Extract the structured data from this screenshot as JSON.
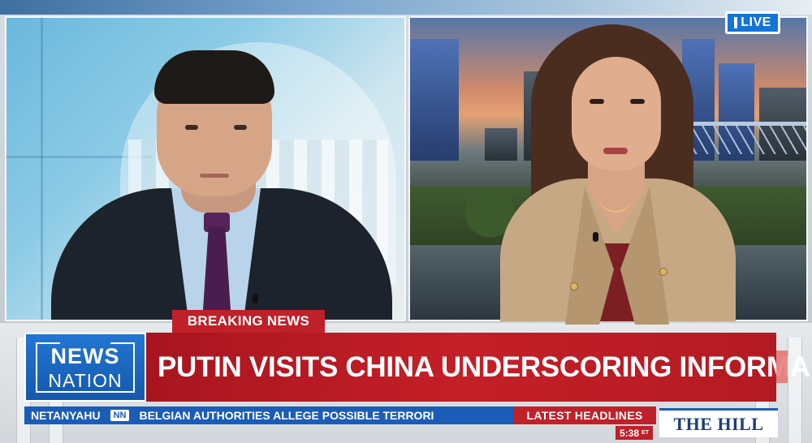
{
  "broadcast": {
    "live_label": "LIVE",
    "breaking_label": "BREAKING NEWS",
    "network": {
      "line1": "NEWS",
      "line2": "NATION"
    },
    "headline": "PUTIN VISITS CHINA UNDERSCORING INFORMAL ALLIANCE",
    "ticker": {
      "items": [
        "NETANYAHU",
        "BELGIAN AUTHORITIES ALLEGE POSSIBLE TERRORI"
      ],
      "separator": "NN"
    },
    "latest_label": "LATEST HEADLINES",
    "time": "5:38",
    "time_zone": "ET",
    "partner_logo": "THE HILL"
  },
  "colors": {
    "brand_blue": "#1b5cb8",
    "breaking_red": "#c0202a"
  }
}
